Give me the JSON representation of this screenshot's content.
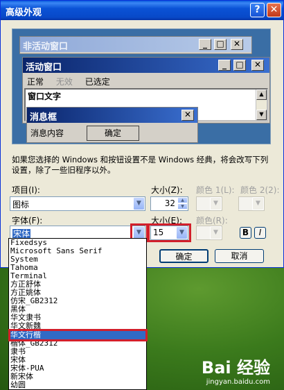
{
  "dialog": {
    "title": "高级外观",
    "help": "?",
    "close": "✕"
  },
  "preview": {
    "inactive_title": "非活动窗口",
    "active_title": "活动窗口",
    "menu": [
      "正常",
      "无效",
      "已选定"
    ],
    "window_text": "窗口文字",
    "msgbox_title": "消息框",
    "msgbox_text": "消息内容",
    "msgbox_ok": "确定"
  },
  "description": "如果您选择的 Windows 和按钮设置不是 Windows 经典，将会改写下列设置，除了一些旧程序以外。",
  "item": {
    "label": "项目(I):",
    "value": "图标"
  },
  "size1": {
    "label": "大小(Z):",
    "value": "32"
  },
  "color1": {
    "label": "颜色 1(L):"
  },
  "color2": {
    "label": "颜色 2(2):"
  },
  "font": {
    "label": "字体(F):",
    "value": "宋体"
  },
  "size2": {
    "label": "大小(E):",
    "value": "15"
  },
  "color3": {
    "label": "颜色(R):"
  },
  "bold": "B",
  "italic": "I",
  "ok": "确定",
  "cancel": "取消",
  "font_list": [
    "Fixedsys",
    "Microsoft Sans Serif",
    "System",
    "Tahoma",
    "Terminal",
    "方正舒体",
    "方正姚体",
    "仿宋_GB2312",
    "黑体",
    "华文隶书",
    "华文新魏",
    "华文行楷",
    "楷体_GB2312",
    "隶书",
    "宋体",
    "宋体-PUA",
    "新宋体",
    "幼圆"
  ],
  "font_list_highlight": "华文行楷",
  "watermark": {
    "brand": "Bai 经验",
    "url": "jingyan.baidu.com"
  }
}
